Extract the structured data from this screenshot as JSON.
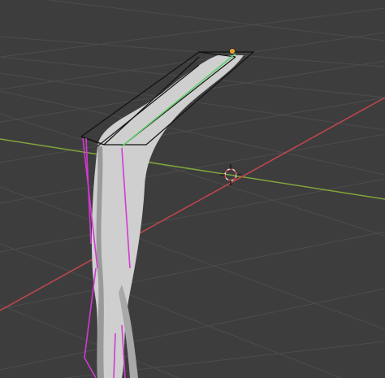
{
  "viewport": {
    "background": "#3d3d3d",
    "grid_color": "#4d4d4d",
    "x_axis_color": "#c4454e",
    "y_axis_color": "#7fa63a",
    "mesh_color": "#cfcfcf",
    "mesh_shadow_color": "#8f8f8f",
    "wire_color": "#111111",
    "selected_edge_color": "#d23ad2",
    "active_edge_color": "#5fcf6a",
    "cursor_color": "#e8e8e8",
    "cursor_accent": "#d94a4a",
    "light_color": "#e0a030"
  },
  "icons": [
    "3d-cursor-icon",
    "light-icon"
  ]
}
